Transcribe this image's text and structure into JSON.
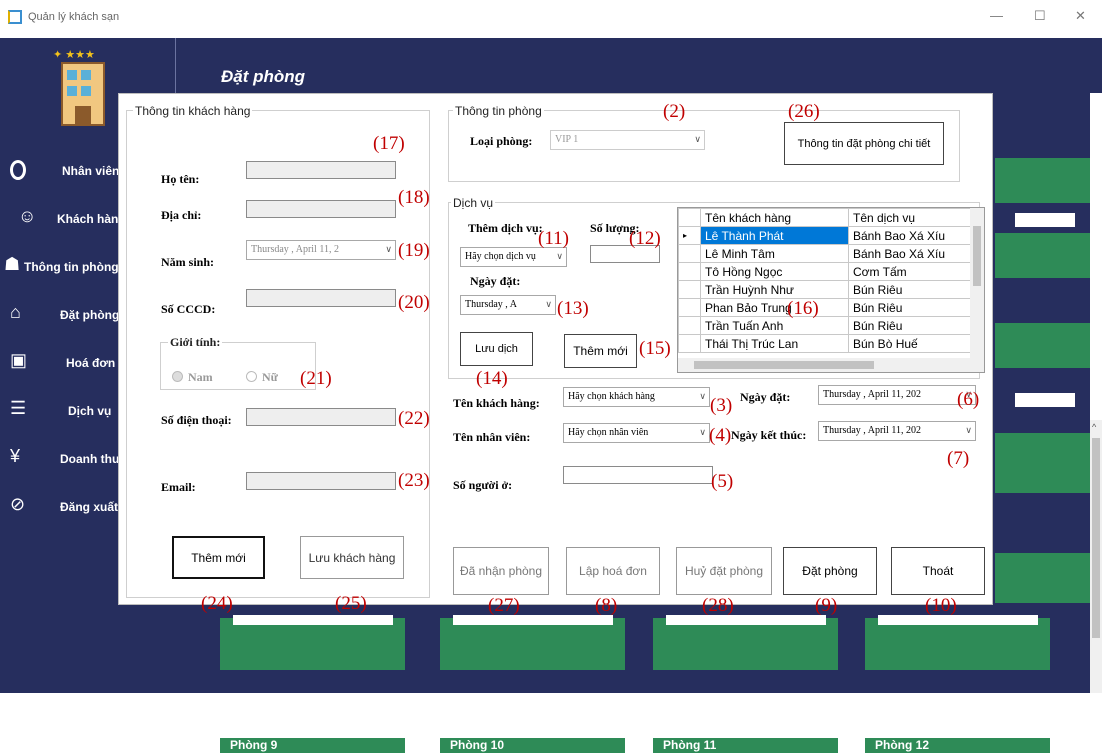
{
  "window": {
    "title": "Quản lý khách sạn",
    "min": "—",
    "max": "☐",
    "close": "✕"
  },
  "header": {
    "title": "Đặt phòng"
  },
  "sidebar": {
    "items": [
      {
        "label": "Nhân viên",
        "icon": "ring-icon"
      },
      {
        "label": "Khách hàng",
        "icon": "customer-icon"
      },
      {
        "label": "Thông tin phòng",
        "icon": "robot-icon"
      },
      {
        "label": "Đặt phòng",
        "icon": "store-icon"
      },
      {
        "label": "Hoá đơn",
        "icon": "money-icon"
      },
      {
        "label": "Dịch vụ",
        "icon": "service-icon"
      },
      {
        "label": "Doanh thu",
        "icon": "revenue-icon"
      },
      {
        "label": "Đăng xuất",
        "icon": "logout-icon"
      }
    ]
  },
  "customer": {
    "group_title": "Thông tin khách hàng",
    "name_label": "Họ tên:",
    "address_label": "Địa chỉ:",
    "birth_label": "Năm sinh:",
    "birth_value": "Thursday ,    April    11, 2",
    "cccd_label": "Số CCCD:",
    "gender_label": "Giới tính:",
    "male": "Nam",
    "female": "Nữ",
    "phone_label": "Số điện thoại:",
    "email_label": "Email:",
    "new_btn": "Thêm mới",
    "save_btn": "Lưu khách hàng"
  },
  "room": {
    "group_title": "Thông tin phòng",
    "type_label": "Loại phòng:",
    "type_value": "VIP 1",
    "detail_btn": "Thông tin đặt phòng chi tiết"
  },
  "service": {
    "group_title": "Dịch vụ",
    "add_label": "Thêm dịch vụ:",
    "qty_label": "Số lượng:",
    "select_value": "Hãy chọn dịch vụ",
    "date_label": "Ngày đặt:",
    "date_value": "Thursday ,    A",
    "save_btn": "Lưu dịch",
    "new_btn": "Thêm mới",
    "columns": [
      "Tên khách hàng",
      "Tên dịch vụ"
    ],
    "rows": [
      [
        "Lê Thành Phát",
        "Bánh Bao Xá Xíu"
      ],
      [
        "Lê Minh Tâm",
        "Bánh Bao Xá Xíu"
      ],
      [
        "Tô Hồng Ngọc",
        "Cơm Tấm"
      ],
      [
        "Trần Huỳnh Như",
        "Bún Riêu"
      ],
      [
        "Phan Bảo Trung",
        "Bún Riêu"
      ],
      [
        "Trần Tuấn Anh",
        "Bún Riêu"
      ],
      [
        "Thái Thị Trúc Lan",
        "Bún Bò Huế"
      ]
    ]
  },
  "booking": {
    "cust_label": "Tên khách hàng:",
    "cust_value": "Hãy chọn khách hàng",
    "emp_label": "Tên nhân viên:",
    "emp_value": "Hãy chọn nhân viên",
    "people_label": "Số người ở:",
    "date_label": "Ngày đặt:",
    "date_value": "Thursday ,    April    11, 202",
    "end_label": "Ngày kết thúc:",
    "end_value": "Thursday ,    April    11, 202"
  },
  "actions": {
    "checked_in": "Đã nhận phòng",
    "invoice": "Lập hoá đơn",
    "cancel": "Huỷ đặt phòng",
    "book": "Đặt phòng",
    "exit": "Thoát"
  },
  "annotations": [
    "(17)",
    "(18)",
    "(19)",
    "(20)",
    "(21)",
    "(22)",
    "(23)",
    "(24)",
    "(25)",
    "(2)",
    "(26)",
    "(11)",
    "(12)",
    "(13)",
    "(14)",
    "(15)",
    "(16)",
    "(3)",
    "(4)",
    "(5)",
    "(6)",
    "(7)",
    "(27)",
    "(8)",
    "(28)",
    "(9)",
    "(10)"
  ],
  "background": {
    "rooms": [
      "Phòng 9",
      "Phòng 10",
      "Phòng 11",
      "Phòng 12"
    ]
  }
}
